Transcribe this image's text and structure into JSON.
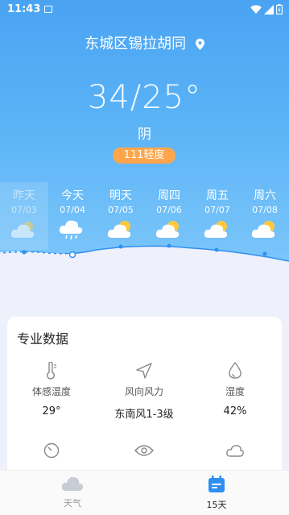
{
  "status": {
    "time": "11:43"
  },
  "location": {
    "name": "东城区锡拉胡同"
  },
  "current": {
    "temp": "34/25°",
    "condition": "阴",
    "aqi": "111轻度"
  },
  "days": [
    {
      "name": "昨天",
      "date": "07/03",
      "icon": "cloudy-icon",
      "past": true
    },
    {
      "name": "今天",
      "date": "07/04",
      "icon": "cloud-rain-icon"
    },
    {
      "name": "明天",
      "date": "07/05",
      "icon": "partly-cloudy-icon"
    },
    {
      "name": "周四",
      "date": "07/06",
      "icon": "partly-cloudy-icon"
    },
    {
      "name": "周五",
      "date": "07/07",
      "icon": "partly-cloudy-icon"
    },
    {
      "name": "周六",
      "date": "07/08",
      "icon": "partly-cloudy-icon"
    }
  ],
  "pro": {
    "title": "专业数据",
    "metrics": [
      {
        "label": "体感温度",
        "value": "29°",
        "icon": "thermometer-icon"
      },
      {
        "label": "风向风力",
        "value": "东南风1-3级",
        "icon": "wind-direction-icon"
      },
      {
        "label": "湿度",
        "value": "42%",
        "icon": "humidity-icon"
      }
    ]
  },
  "nav": {
    "weather": "天气",
    "fifteen": "15天"
  },
  "colors": {
    "accent": "#2f8ff0",
    "aqi": "#ffa64d",
    "sky": "#4aa3f2"
  }
}
